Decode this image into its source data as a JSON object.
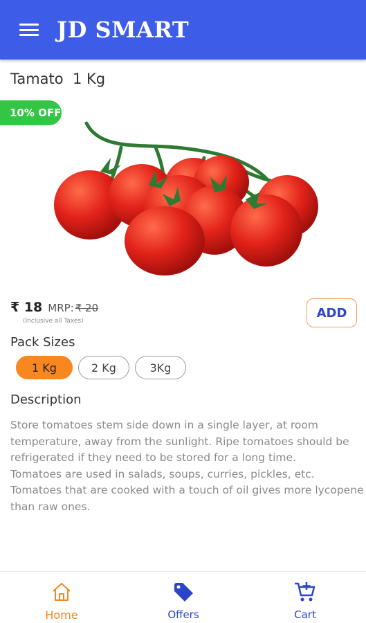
{
  "app_bar": {
    "title": "JD SMART",
    "menu_icon": "menu-icon"
  },
  "product": {
    "title": "Tamato  1 Kg",
    "discount_badge": "10% OFF",
    "image_icon": "tomatoes-image",
    "price": "₹ 18",
    "mrp_label": "MRP:",
    "mrp_value": "₹ 20",
    "tax_note": "(Inclusive all Taxes)",
    "add_label": "ADD"
  },
  "pack_sizes": {
    "title": "Pack Sizes",
    "options": [
      "1 Kg",
      "2 Kg",
      "3Kg"
    ],
    "selected": "1 Kg"
  },
  "description": {
    "title": "Description",
    "lines": [
      "Store tomatoes stem side down in a single layer, at room",
      "temperature, away from the sunlight. Ripe tomatoes should be",
      "refrigerated if they need to be stored for a long time.",
      "Tomatoes are used in salads, soups, curries, pickles, etc.",
      "Tomatoes that are cooked with a touch of oil gives more lycopene",
      "than raw ones."
    ]
  },
  "bottom_nav": {
    "items": [
      {
        "label": "Home",
        "icon": "home-icon"
      },
      {
        "label": "Offers",
        "icon": "tag-icon"
      },
      {
        "label": "Cart",
        "icon": "cart-add-icon"
      }
    ],
    "active": "Home"
  },
  "colors": {
    "app_bar": "#3d5ce8",
    "badge": "#33c644",
    "accent_orange": "#f9871f",
    "nav_blue": "#2c45c8"
  }
}
